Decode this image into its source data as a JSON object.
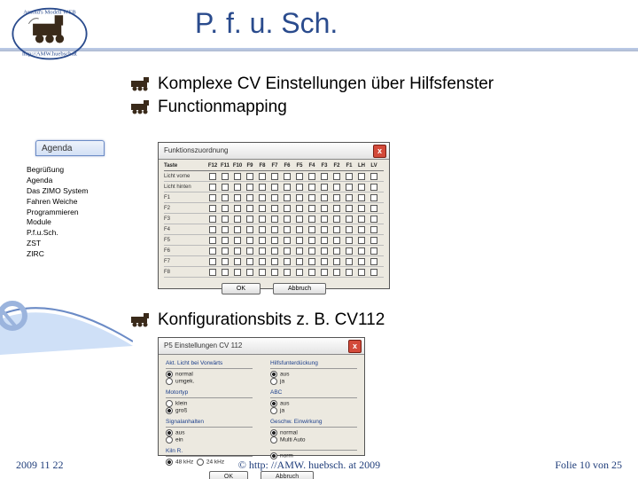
{
  "title": "P. f. u. Sch.",
  "agenda_label": "Agenda",
  "agenda": {
    "items": [
      "Begrüßung",
      "Agenda",
      "Das ZIMO System",
      "Fahren Weiche",
      "Programmieren",
      "Module",
      "P.f.u.Sch.",
      "ZST",
      "ZIRC"
    ]
  },
  "bullets": {
    "b1": "Komplexe CV Einstellungen über Hilfsfenster",
    "b2": "Functionmapping",
    "b3": "Konfigurationsbits z. B. CV112"
  },
  "fm": {
    "title": "Funktionszuordnung",
    "taste": "Taste",
    "cols": [
      "F12",
      "F11",
      "F10",
      "F9",
      "F8",
      "F7",
      "F6",
      "F5",
      "F4",
      "F3",
      "F2",
      "F1",
      "LH",
      "LV"
    ],
    "rows": [
      "Licht vorne",
      "Licht hinten",
      "F1",
      "F2",
      "F3",
      "F4",
      "F5",
      "F6",
      "F7",
      "F8"
    ],
    "ok": "OK",
    "cancel": "Abbruch"
  },
  "cv": {
    "title": "P5 Einstellungen CV 112",
    "l1_h": "Akt. Licht bei Vorwärts",
    "r1_h": "Hilfsfunterdückung",
    "l1a": "normal",
    "l1b": "umgek.",
    "r1a": "aus",
    "r1b": "ja",
    "l2_h": "Motortyp",
    "r2_h": "ABC",
    "l2a": "klein",
    "l2b": "groß",
    "r2a": "aus",
    "r2b": "ja",
    "l3_h": "Signalanhalten",
    "r3_h": "Geschw. Einwirkung",
    "l3a": "aus",
    "l3b": "ein",
    "r3a": "normal",
    "r3b": "Multi Auto",
    "l4_h": "Kiln R.",
    "r4_h": "",
    "l4a": "48 kHz",
    "l4b": "24 kHz",
    "r4a": "norm",
    "r4b": "",
    "ok": "OK",
    "cancel": "Abbruch"
  },
  "footer": {
    "date": "2009 11 22",
    "copy": "© http: //AMW. huebsch. at 2009",
    "page": "Folie 10 von  25"
  }
}
